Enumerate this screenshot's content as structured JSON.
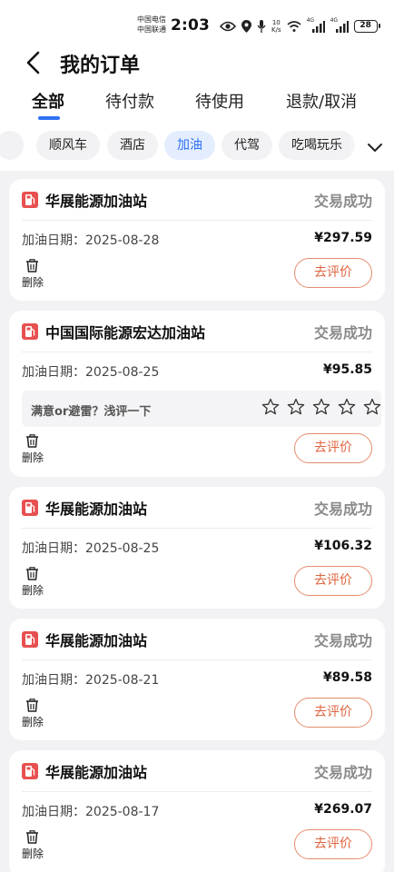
{
  "status_bar": {
    "carrier_1": "中国电信",
    "carrier_2": "中国联通",
    "time": "2:03",
    "net_speed_value": "10",
    "net_speed_unit": "K/s",
    "signal_1": "4G",
    "signal_2": "4G",
    "battery": "28"
  },
  "header": {
    "title": "我的订单"
  },
  "tabs": [
    {
      "label": "全部",
      "active": true
    },
    {
      "label": "待付款"
    },
    {
      "label": "待使用"
    },
    {
      "label": "退款/取消"
    }
  ],
  "categories": [
    {
      "label": "顺风车"
    },
    {
      "label": "酒店"
    },
    {
      "label": "加油",
      "active": true
    },
    {
      "label": "代驾"
    },
    {
      "label": "吃喝玩乐"
    }
  ],
  "orders": [
    {
      "station": "华展能源加油站",
      "status": "交易成功",
      "date_label": "加油日期：",
      "date": "2025-08-28",
      "price": "¥297.59",
      "delete_label": "删除",
      "review_label": "去评价"
    },
    {
      "station": "中国国际能源宏达加油站",
      "status": "交易成功",
      "date_label": "加油日期：",
      "date": "2025-08-25",
      "price": "¥95.85",
      "feedback_prompt": "满意or避雷？浅评一下",
      "delete_label": "删除",
      "review_label": "去评价"
    },
    {
      "station": "华展能源加油站",
      "status": "交易成功",
      "date_label": "加油日期：",
      "date": "2025-08-25",
      "price": "¥106.32",
      "delete_label": "删除",
      "review_label": "去评价"
    },
    {
      "station": "华展能源加油站",
      "status": "交易成功",
      "date_label": "加油日期：",
      "date": "2025-08-21",
      "price": "¥89.58",
      "delete_label": "删除",
      "review_label": "去评价"
    },
    {
      "station": "华展能源加油站",
      "status": "交易成功",
      "date_label": "加油日期：",
      "date": "2025-08-17",
      "price": "¥269.07",
      "delete_label": "删除",
      "review_label": "去评价"
    }
  ],
  "colors": {
    "accent": "#2f6ff5",
    "review": "#e0633e",
    "station_icon": "#e8504f",
    "status_text": "#8a8a8a"
  },
  "icons": {
    "back": "chevron-left-icon",
    "expand": "chevron-down-icon",
    "station": "fuel-pump-icon",
    "delete": "trash-icon",
    "rating": "star-outline-icon"
  }
}
